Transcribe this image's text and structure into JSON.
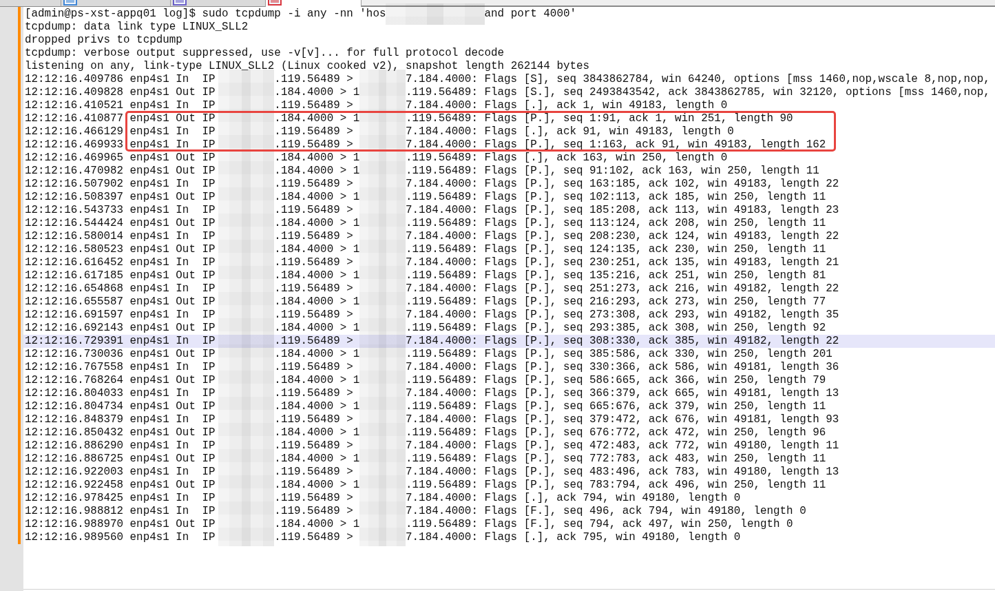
{
  "tab_strip": {
    "tabs": [
      {
        "selected": false
      },
      {
        "selected": false,
        "color": "#3f86d6"
      },
      {
        "selected": false,
        "color": "#6a5fc8"
      },
      {
        "selected": true,
        "color": "#d9363e"
      }
    ]
  },
  "editor": {
    "lines": [
      {
        "kind": "command",
        "before": "[admin@ps-xst-appq01 log]$ sudo tcpdump -i any -nn 'hos",
        "after": "and port 4000'",
        "selected": false,
        "boxed": false
      },
      {
        "kind": "text",
        "text": "tcpdump: data link type LINUX_SLL2",
        "selected": false,
        "boxed": false
      },
      {
        "kind": "text",
        "text": "dropped privs to tcpdump",
        "selected": false,
        "boxed": false
      },
      {
        "kind": "text",
        "text": "tcpdump: verbose output suppressed, use -v[v]... for full protocol decode",
        "selected": false,
        "boxed": false
      },
      {
        "kind": "text",
        "text": "listening on any, link-type LINUX_SLL2 (Linux cooked v2), snapshot length 262144 bytes",
        "selected": false,
        "boxed": false
      },
      {
        "kind": "packet",
        "time": "12:12:16.409786",
        "interface": "enp4s1",
        "direction": "In",
        "protocol": "IP",
        "source": ".119.56489 >",
        "destination": "7.184.4000:",
        "info": "Flags [S], seq 3843862784, win 64240, options [mss 1460,nop,wscale 8,nop,nop,",
        "selected": false,
        "boxed": false
      },
      {
        "kind": "packet",
        "time": "12:12:16.409828",
        "interface": "enp4s1",
        "direction": "Out",
        "protocol": "IP",
        "source": ".184.4000 > 1",
        "destination": ".119.56489:",
        "info": "Flags [S.], seq 2493843542, ack 3843862785, win 32120, options [mss 1460,nop,",
        "selected": false,
        "boxed": false
      },
      {
        "kind": "packet",
        "time": "12:12:16.410521",
        "interface": "enp4s1",
        "direction": "In",
        "protocol": "IP",
        "source": ".119.56489 >",
        "destination": "7.184.4000:",
        "info": "Flags [.], ack 1, win 49183, length 0",
        "selected": false,
        "boxed": false
      },
      {
        "kind": "packet",
        "time": "12:12:16.410877",
        "interface": "enp4s1",
        "direction": "Out",
        "protocol": "IP",
        "source": ".184.4000 > 1",
        "destination": ".119.56489:",
        "info": "Flags [P.], seq 1:91, ack 1, win 251, length 90",
        "selected": false,
        "boxed": true
      },
      {
        "kind": "packet",
        "time": "12:12:16.466129",
        "interface": "enp4s1",
        "direction": "In",
        "protocol": "IP",
        "source": ".119.56489 >",
        "destination": "7.184.4000:",
        "info": "Flags [.], ack 91, win 49183, length 0",
        "selected": false,
        "boxed": true
      },
      {
        "kind": "packet",
        "time": "12:12:16.469933",
        "interface": "enp4s1",
        "direction": "In",
        "protocol": "IP",
        "source": ".119.56489 >",
        "destination": "7.184.4000:",
        "info": "Flags [P.], seq 1:163, ack 91, win 49183, length 162",
        "selected": false,
        "boxed": true
      },
      {
        "kind": "packet",
        "time": "12:12:16.469965",
        "interface": "enp4s1",
        "direction": "Out",
        "protocol": "IP",
        "source": ".184.4000 > 1",
        "destination": ".119.56489:",
        "info": "Flags [.], ack 163, win 250, length 0",
        "selected": false,
        "boxed": false
      },
      {
        "kind": "packet",
        "time": "12:12:16.470982",
        "interface": "enp4s1",
        "direction": "Out",
        "protocol": "IP",
        "source": ".184.4000 > 1",
        "destination": ".119.56489:",
        "info": "Flags [P.], seq 91:102, ack 163, win 250, length 11",
        "selected": false,
        "boxed": false
      },
      {
        "kind": "packet",
        "time": "12:12:16.507902",
        "interface": "enp4s1",
        "direction": "In",
        "protocol": "IP",
        "source": ".119.56489 >",
        "destination": "7.184.4000:",
        "info": "Flags [P.], seq 163:185, ack 102, win 49183, length 22",
        "selected": false,
        "boxed": false
      },
      {
        "kind": "packet",
        "time": "12:12:16.508397",
        "interface": "enp4s1",
        "direction": "Out",
        "protocol": "IP",
        "source": ".184.4000 > 1",
        "destination": ".119.56489:",
        "info": "Flags [P.], seq 102:113, ack 185, win 250, length 11",
        "selected": false,
        "boxed": false
      },
      {
        "kind": "packet",
        "time": "12:12:16.543733",
        "interface": "enp4s1",
        "direction": "In",
        "protocol": "IP",
        "source": ".119.56489 >",
        "destination": "7.184.4000:",
        "info": "Flags [P.], seq 185:208, ack 113, win 49183, length 23",
        "selected": false,
        "boxed": false
      },
      {
        "kind": "packet",
        "time": "12:12:16.544424",
        "interface": "enp4s1",
        "direction": "Out",
        "protocol": "IP",
        "source": ".184.4000 > 1",
        "destination": ".119.56489:",
        "info": "Flags [P.], seq 113:124, ack 208, win 250, length 11",
        "selected": false,
        "boxed": false
      },
      {
        "kind": "packet",
        "time": "12:12:16.580014",
        "interface": "enp4s1",
        "direction": "In",
        "protocol": "IP",
        "source": ".119.56489 >",
        "destination": "7.184.4000:",
        "info": "Flags [P.], seq 208:230, ack 124, win 49183, length 22",
        "selected": false,
        "boxed": false
      },
      {
        "kind": "packet",
        "time": "12:12:16.580523",
        "interface": "enp4s1",
        "direction": "Out",
        "protocol": "IP",
        "source": ".184.4000 > 1",
        "destination": ".119.56489:",
        "info": "Flags [P.], seq 124:135, ack 230, win 250, length 11",
        "selected": false,
        "boxed": false
      },
      {
        "kind": "packet",
        "time": "12:12:16.616452",
        "interface": "enp4s1",
        "direction": "In",
        "protocol": "IP",
        "source": ".119.56489 >",
        "destination": "7.184.4000:",
        "info": "Flags [P.], seq 230:251, ack 135, win 49183, length 21",
        "selected": false,
        "boxed": false
      },
      {
        "kind": "packet",
        "time": "12:12:16.617185",
        "interface": "enp4s1",
        "direction": "Out",
        "protocol": "IP",
        "source": ".184.4000 > 1",
        "destination": ".119.56489:",
        "info": "Flags [P.], seq 135:216, ack 251, win 250, length 81",
        "selected": false,
        "boxed": false
      },
      {
        "kind": "packet",
        "time": "12:12:16.654868",
        "interface": "enp4s1",
        "direction": "In",
        "protocol": "IP",
        "source": ".119.56489 >",
        "destination": "7.184.4000:",
        "info": "Flags [P.], seq 251:273, ack 216, win 49182, length 22",
        "selected": false,
        "boxed": false
      },
      {
        "kind": "packet",
        "time": "12:12:16.655587",
        "interface": "enp4s1",
        "direction": "Out",
        "protocol": "IP",
        "source": ".184.4000 > 1",
        "destination": ".119.56489:",
        "info": "Flags [P.], seq 216:293, ack 273, win 250, length 77",
        "selected": false,
        "boxed": false
      },
      {
        "kind": "packet",
        "time": "12:12:16.691597",
        "interface": "enp4s1",
        "direction": "In",
        "protocol": "IP",
        "source": ".119.56489 >",
        "destination": "7.184.4000:",
        "info": "Flags [P.], seq 273:308, ack 293, win 49182, length 35",
        "selected": false,
        "boxed": false
      },
      {
        "kind": "packet",
        "time": "12:12:16.692143",
        "interface": "enp4s1",
        "direction": "Out",
        "protocol": "IP",
        "source": ".184.4000 > 1",
        "destination": ".119.56489:",
        "info": "Flags [P.], seq 293:385, ack 308, win 250, length 92",
        "selected": false,
        "boxed": false
      },
      {
        "kind": "packet",
        "time": "12:12:16.729391",
        "interface": "enp4s1",
        "direction": "In",
        "protocol": "IP",
        "source": ".119.56489 >",
        "destination": "7.184.4000:",
        "info": "Flags [P.], seq 308:330, ack 385, win 49182, length 22",
        "selected": true,
        "boxed": false
      },
      {
        "kind": "packet",
        "time": "12:12:16.730036",
        "interface": "enp4s1",
        "direction": "Out",
        "protocol": "IP",
        "source": ".184.4000 > 1",
        "destination": ".119.56489:",
        "info": "Flags [P.], seq 385:586, ack 330, win 250, length 201",
        "selected": false,
        "boxed": false
      },
      {
        "kind": "packet",
        "time": "12:12:16.767558",
        "interface": "enp4s1",
        "direction": "In",
        "protocol": "IP",
        "source": ".119.56489 >",
        "destination": "7.184.4000:",
        "info": "Flags [P.], seq 330:366, ack 586, win 49181, length 36",
        "selected": false,
        "boxed": false
      },
      {
        "kind": "packet",
        "time": "12:12:16.768264",
        "interface": "enp4s1",
        "direction": "Out",
        "protocol": "IP",
        "source": ".184.4000 > 1",
        "destination": ".119.56489:",
        "info": "Flags [P.], seq 586:665, ack 366, win 250, length 79",
        "selected": false,
        "boxed": false
      },
      {
        "kind": "packet",
        "time": "12:12:16.804033",
        "interface": "enp4s1",
        "direction": "In",
        "protocol": "IP",
        "source": ".119.56489 >",
        "destination": "7.184.4000:",
        "info": "Flags [P.], seq 366:379, ack 665, win 49181, length 13",
        "selected": false,
        "boxed": false
      },
      {
        "kind": "packet",
        "time": "12:12:16.804734",
        "interface": "enp4s1",
        "direction": "Out",
        "protocol": "IP",
        "source": ".184.4000 > 1",
        "destination": ".119.56489:",
        "info": "Flags [P.], seq 665:676, ack 379, win 250, length 11",
        "selected": false,
        "boxed": false
      },
      {
        "kind": "packet",
        "time": "12:12:16.848379",
        "interface": "enp4s1",
        "direction": "In",
        "protocol": "IP",
        "source": ".119.56489 >",
        "destination": "7.184.4000:",
        "info": "Flags [P.], seq 379:472, ack 676, win 49181, length 93",
        "selected": false,
        "boxed": false
      },
      {
        "kind": "packet",
        "time": "12:12:16.850432",
        "interface": "enp4s1",
        "direction": "Out",
        "protocol": "IP",
        "source": ".184.4000 > 1",
        "destination": ".119.56489:",
        "info": "Flags [P.], seq 676:772, ack 472, win 250, length 96",
        "selected": false,
        "boxed": false
      },
      {
        "kind": "packet",
        "time": "12:12:16.886290",
        "interface": "enp4s1",
        "direction": "In",
        "protocol": "IP",
        "source": ".119.56489 >",
        "destination": "7.184.4000:",
        "info": "Flags [P.], seq 472:483, ack 772, win 49180, length 11",
        "selected": false,
        "boxed": false
      },
      {
        "kind": "packet",
        "time": "12:12:16.886725",
        "interface": "enp4s1",
        "direction": "Out",
        "protocol": "IP",
        "source": ".184.4000 > 1",
        "destination": ".119.56489:",
        "info": "Flags [P.], seq 772:783, ack 483, win 250, length 11",
        "selected": false,
        "boxed": false
      },
      {
        "kind": "packet",
        "time": "12:12:16.922003",
        "interface": "enp4s1",
        "direction": "In",
        "protocol": "IP",
        "source": ".119.56489 >",
        "destination": "7.184.4000:",
        "info": "Flags [P.], seq 483:496, ack 783, win 49180, length 13",
        "selected": false,
        "boxed": false
      },
      {
        "kind": "packet",
        "time": "12:12:16.922458",
        "interface": "enp4s1",
        "direction": "Out",
        "protocol": "IP",
        "source": ".184.4000 > 1",
        "destination": ".119.56489:",
        "info": "Flags [P.], seq 783:794, ack 496, win 250, length 11",
        "selected": false,
        "boxed": false
      },
      {
        "kind": "packet",
        "time": "12:12:16.978425",
        "interface": "enp4s1",
        "direction": "In",
        "protocol": "IP",
        "source": ".119.56489 >",
        "destination": "7.184.4000:",
        "info": "Flags [.], ack 794, win 49180, length 0",
        "selected": false,
        "boxed": false
      },
      {
        "kind": "packet",
        "time": "12:12:16.988812",
        "interface": "enp4s1",
        "direction": "In",
        "protocol": "IP",
        "source": ".119.56489 >",
        "destination": "7.184.4000:",
        "info": "Flags [F.], seq 496, ack 794, win 49180, length 0",
        "selected": false,
        "boxed": false
      },
      {
        "kind": "packet",
        "time": "12:12:16.988970",
        "interface": "enp4s1",
        "direction": "Out",
        "protocol": "IP",
        "source": ".184.4000 > 1",
        "destination": ".119.56489:",
        "info": "Flags [F.], seq 794, ack 497, win 250, length 0",
        "selected": false,
        "boxed": false
      },
      {
        "kind": "packet",
        "time": "12:12:16.989560",
        "interface": "enp4s1",
        "direction": "In",
        "protocol": "IP",
        "source": ".119.56489 >",
        "destination": "7.184.4000:",
        "info": "Flags [.], ack 795, win 49180, length 0",
        "selected": false,
        "boxed": false
      }
    ]
  }
}
